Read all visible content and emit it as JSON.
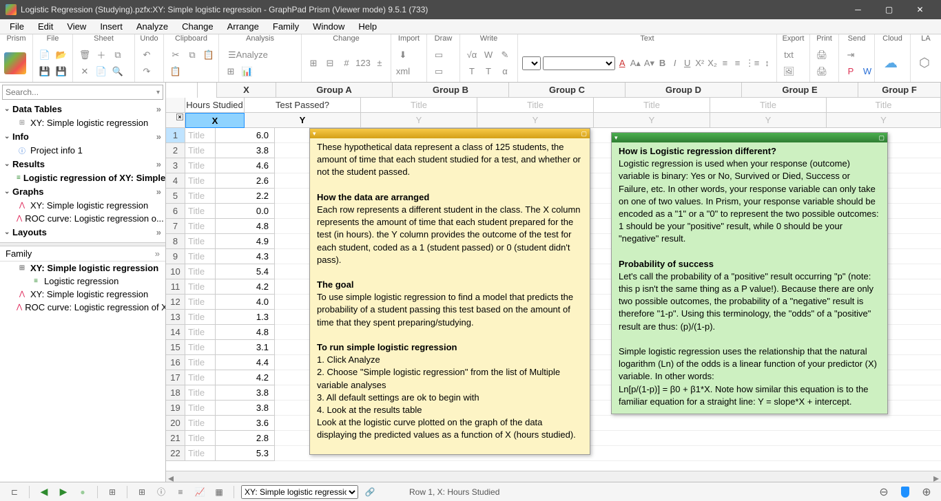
{
  "window": {
    "title": "Logistic Regression (Studying).pzfx:XY: Simple logistic regression - GraphPad Prism (Viewer mode) 9.5.1 (733)"
  },
  "menu": [
    "File",
    "Edit",
    "View",
    "Insert",
    "Analyze",
    "Change",
    "Arrange",
    "Family",
    "Window",
    "Help"
  ],
  "ribbon": {
    "groups": [
      "Prism",
      "File",
      "Sheet",
      "Undo",
      "Clipboard",
      "Analysis",
      "Change",
      "Import",
      "Draw",
      "Write",
      "Text",
      "Export",
      "Print",
      "Send",
      "Cloud",
      "LA"
    ],
    "analyze_btn": "Analyze"
  },
  "sidebar": {
    "search_placeholder": "Search...",
    "sections": [
      {
        "label": "Data Tables",
        "items": [
          {
            "icon": "tbl",
            "label": "XY: Simple logistic regression"
          }
        ]
      },
      {
        "label": "Info",
        "items": [
          {
            "icon": "info",
            "label": "Project info 1"
          }
        ]
      },
      {
        "label": "Results",
        "items": [
          {
            "icon": "green",
            "label": "Logistic regression of XY: Simple...",
            "sel": true
          }
        ]
      },
      {
        "label": "Graphs",
        "items": [
          {
            "icon": "red",
            "label": "XY: Simple logistic regression"
          },
          {
            "icon": "red",
            "label": "ROC curve: Logistic regression o..."
          }
        ]
      },
      {
        "label": "Layouts",
        "items": []
      }
    ],
    "family_label": "Family",
    "family": [
      {
        "icon": "tbl",
        "label": "XY: Simple logistic regression",
        "sel": true
      },
      {
        "icon": "green",
        "label": "Logistic regression",
        "indent": true
      },
      {
        "icon": "red",
        "label": "XY: Simple logistic regression"
      },
      {
        "icon": "red",
        "label": "ROC curve: Logistic regression of X"
      }
    ]
  },
  "grid": {
    "group_header": {
      "x": "X",
      "groups": [
        "Group A",
        "Group B",
        "Group C",
        "Group D",
        "Group E",
        "Group F"
      ]
    },
    "col_header": {
      "x": "Hours Studied",
      "a": "Test Passed?",
      "ph": "Title"
    },
    "sub_header": {
      "x": "X",
      "y": "Y"
    },
    "row_title_ph": "Title",
    "rows": [
      6.0,
      3.8,
      4.6,
      2.6,
      2.2,
      0.0,
      4.8,
      4.9,
      4.3,
      5.4,
      4.2,
      4.0,
      1.3,
      4.8,
      3.1,
      4.4,
      4.2,
      3.8,
      3.8,
      3.6,
      2.8,
      5.3
    ]
  },
  "note_yellow": {
    "p1": "These hypothetical data represent a class of 125 students, the amount of time that each student studied for a test, and whether or not the student passed.",
    "h2": "How the data are arranged",
    "p2": "Each row represents a different student in the class. The X column represents the amount of time that each student prepared for the test (in hours). the Y column provides the outcome of the test for each student, coded as a 1 (student passed) or 0 (student didn't pass).",
    "h3": "The goal",
    "p3": "To use simple logistic regression to find a model that predicts the probability of a student passing this test based on the amount of time that they spent preparing/studying.",
    "h4": "To run simple logistic regression",
    "l1": "1. Click Analyze",
    "l2": "2. Choose \"Simple logistic regression\" from the list of Multiple variable analyses",
    "l3": "3. All default settings are ok to begin with",
    "l4": "4. Look at the results table",
    "p4": "Look at the logistic curve plotted on the graph of the data displaying the predicted values as a function of X (hours studied)."
  },
  "note_green": {
    "h1": "How is Logistic regression different?",
    "p1": "Logistic regression is used when your response (outcome) variable is binary: Yes or No, Survived or Died, Success or Failure, etc. In other words, your response variable can only take on one of two values. In Prism, your response variable should be encoded as a \"1\" or a \"0\" to represent the two possible outcomes: 1 should be your \"positive\" result, while 0 should be your \"negative\" result.",
    "h2": "Probability of success",
    "p2": "Let's call the probability of a \"positive\" result occurring \"p\" (note: this p isn't the same thing as a P value!). Because there are only two possible outcomes, the probability of a \"negative\" result is therefore \"1-p\". Using this terminology, the \"odds\" of a \"positive\" result are thus: (p)/(1-p).",
    "p3": "Simple logistic regression uses the relationship that the natural logarithm (Ln) of the odds is a linear function of your predictor (X) variable. In other words:",
    "p4": "Ln[p/(1-p)] = β0 + β1*X. Note how similar this equation is to the familiar equation for a straight line: Y = slope*X + intercept."
  },
  "status": {
    "sheet_selector": "XY: Simple logistic regression",
    "coord": "Row 1, X: Hours Studied"
  }
}
